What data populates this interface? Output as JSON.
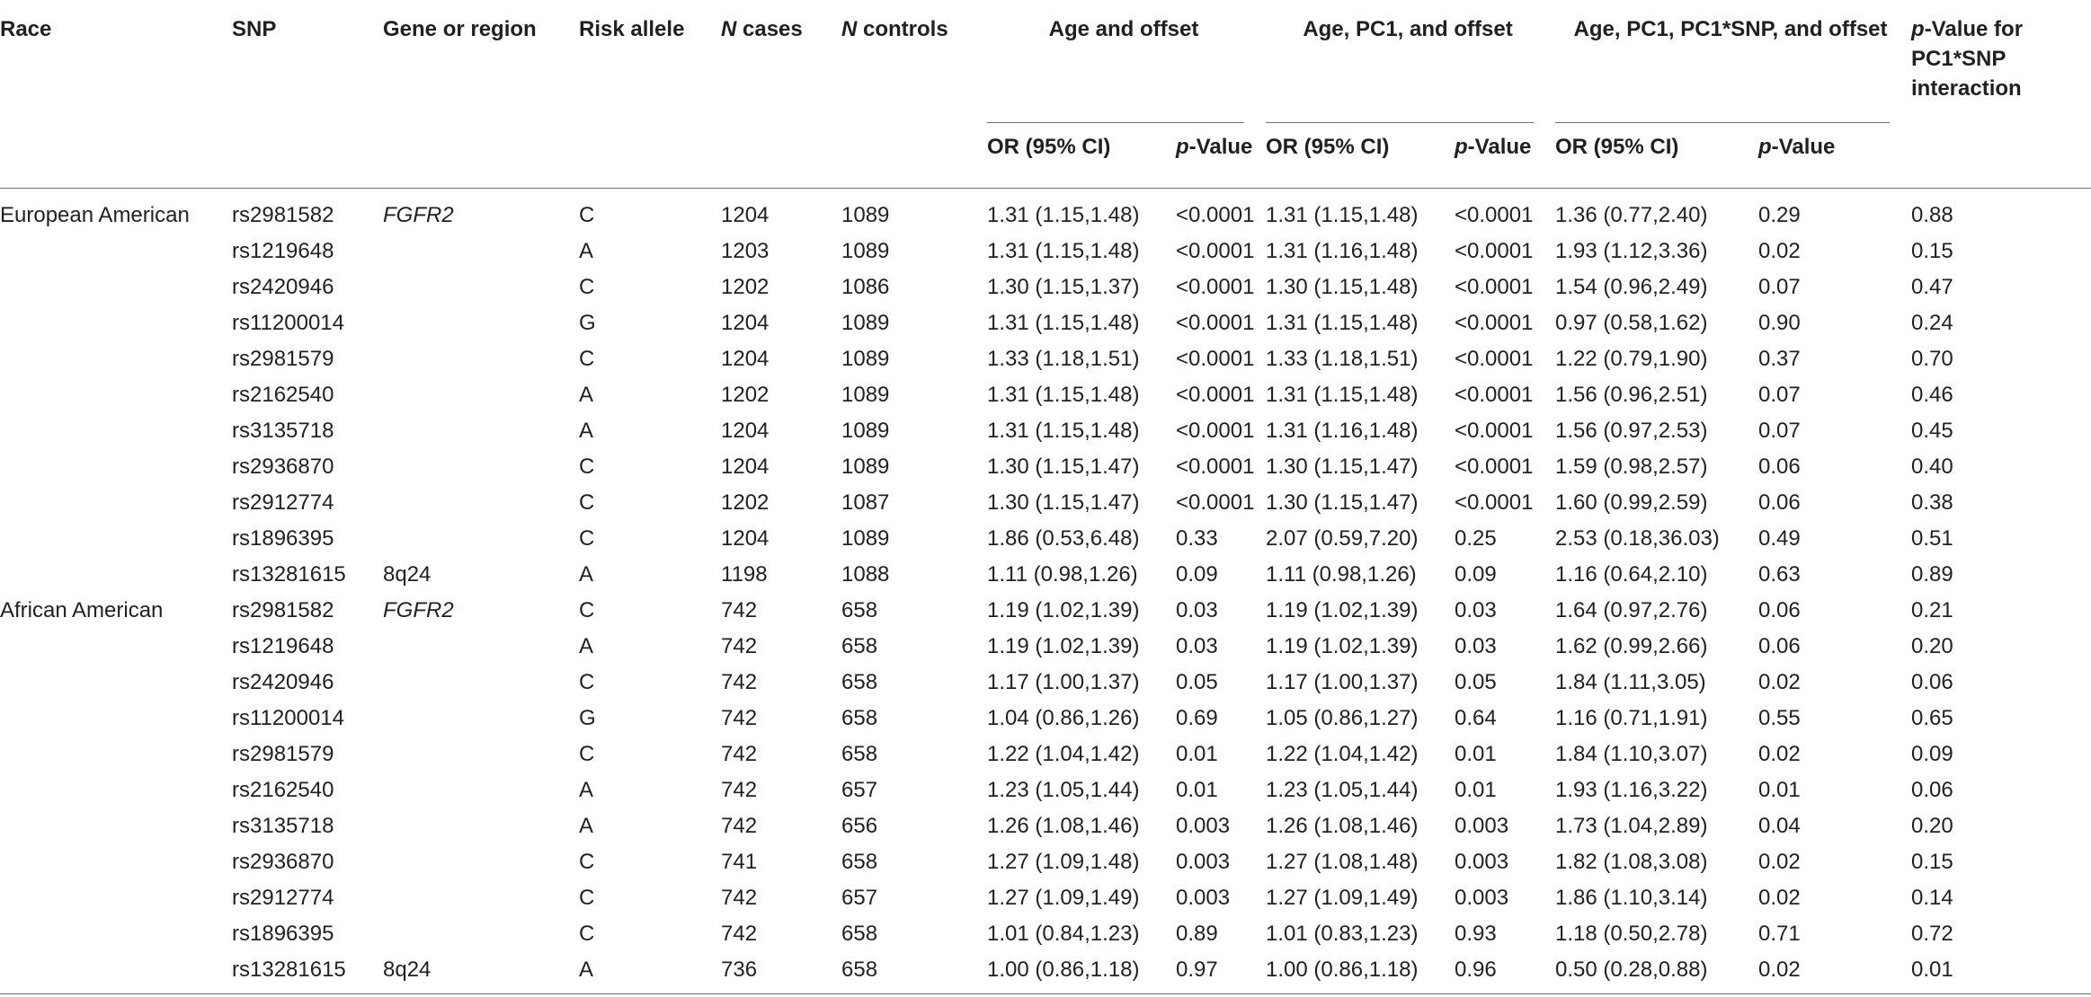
{
  "header": {
    "race": "Race",
    "snp": "SNP",
    "gene": "Gene or region",
    "risk": "Risk allele",
    "ncases_n": "N",
    "ncases_rest": " cases",
    "ncontrols_n": "N",
    "ncontrols_rest": " controls",
    "group1": "Age and offset",
    "group2": "Age, PC1, and offset",
    "group3": "Age, PC1, PC1*SNP, and offset",
    "or": "OR (95% CI)",
    "p_italic": "p",
    "p_rest": "-Value",
    "pint_italic": "p",
    "pint_rest_1": "-Value for",
    "pint_rest_2": "PC1*SNP",
    "pint_rest_3": "interaction"
  },
  "rows": [
    {
      "race": "European American",
      "snp": "rs2981582",
      "gene": "FGFR2",
      "risk": "C",
      "ncases": "1204",
      "ncontrols": "1089",
      "or1": "1.31 (1.15,1.48)",
      "p1": "<0.0001",
      "or2": "1.31 (1.15,1.48)",
      "p2": "<0.0001",
      "or3": "1.36 (0.77,2.40)",
      "p3": "0.29",
      "pint": "0.88"
    },
    {
      "race": "",
      "snp": "rs1219648",
      "gene": "",
      "risk": "A",
      "ncases": "1203",
      "ncontrols": "1089",
      "or1": "1.31 (1.15,1.48)",
      "p1": "<0.0001",
      "or2": "1.31 (1.16,1.48)",
      "p2": "<0.0001",
      "or3": "1.93 (1.12,3.36)",
      "p3": "0.02",
      "pint": "0.15"
    },
    {
      "race": "",
      "snp": "rs2420946",
      "gene": "",
      "risk": "C",
      "ncases": "1202",
      "ncontrols": "1086",
      "or1": "1.30 (1.15,1.37)",
      "p1": "<0.0001",
      "or2": "1.30 (1.15,1.48)",
      "p2": "<0.0001",
      "or3": "1.54 (0.96,2.49)",
      "p3": "0.07",
      "pint": "0.47"
    },
    {
      "race": "",
      "snp": "rs11200014",
      "gene": "",
      "risk": "G",
      "ncases": "1204",
      "ncontrols": "1089",
      "or1": "1.31 (1.15,1.48)",
      "p1": "<0.0001",
      "or2": "1.31 (1.15,1.48)",
      "p2": "<0.0001",
      "or3": "0.97 (0.58,1.62)",
      "p3": "0.90",
      "pint": "0.24"
    },
    {
      "race": "",
      "snp": "rs2981579",
      "gene": "",
      "risk": "C",
      "ncases": "1204",
      "ncontrols": "1089",
      "or1": "1.33 (1.18,1.51)",
      "p1": "<0.0001",
      "or2": "1.33 (1.18,1.51)",
      "p2": "<0.0001",
      "or3": "1.22 (0.79,1.90)",
      "p3": "0.37",
      "pint": "0.70"
    },
    {
      "race": "",
      "snp": "rs2162540",
      "gene": "",
      "risk": "A",
      "ncases": "1202",
      "ncontrols": "1089",
      "or1": "1.31 (1.15,1.48)",
      "p1": "<0.0001",
      "or2": "1.31 (1.15,1.48)",
      "p2": "<0.0001",
      "or3": "1.56 (0.96,2.51)",
      "p3": "0.07",
      "pint": "0.46"
    },
    {
      "race": "",
      "snp": "rs3135718",
      "gene": "",
      "risk": "A",
      "ncases": "1204",
      "ncontrols": "1089",
      "or1": "1.31 (1.15,1.48)",
      "p1": "<0.0001",
      "or2": "1.31 (1.16,1.48)",
      "p2": "<0.0001",
      "or3": "1.56 (0.97,2.53)",
      "p3": "0.07",
      "pint": "0.45"
    },
    {
      "race": "",
      "snp": "rs2936870",
      "gene": "",
      "risk": "C",
      "ncases": "1204",
      "ncontrols": "1089",
      "or1": "1.30 (1.15,1.47)",
      "p1": "<0.0001",
      "or2": "1.30 (1.15,1.47)",
      "p2": "<0.0001",
      "or3": "1.59 (0.98,2.57)",
      "p3": "0.06",
      "pint": "0.40"
    },
    {
      "race": "",
      "snp": "rs2912774",
      "gene": "",
      "risk": "C",
      "ncases": "1202",
      "ncontrols": "1087",
      "or1": "1.30 (1.15,1.47)",
      "p1": "<0.0001",
      "or2": "1.30 (1.15,1.47)",
      "p2": "<0.0001",
      "or3": "1.60 (0.99,2.59)",
      "p3": "0.06",
      "pint": "0.38"
    },
    {
      "race": "",
      "snp": "rs1896395",
      "gene": "",
      "risk": "C",
      "ncases": "1204",
      "ncontrols": "1089",
      "or1": "1.86 (0.53,6.48)",
      "p1": "0.33",
      "or2": "2.07 (0.59,7.20)",
      "p2": "0.25",
      "or3": "2.53 (0.18,36.03)",
      "p3": "0.49",
      "pint": "0.51"
    },
    {
      "race": "",
      "snp": "rs13281615",
      "gene": "8q24",
      "risk": "A",
      "ncases": "1198",
      "ncontrols": "1088",
      "or1": "1.11 (0.98,1.26)",
      "p1": "0.09",
      "or2": "1.11 (0.98,1.26)",
      "p2": "0.09",
      "or3": "1.16 (0.64,2.10)",
      "p3": "0.63",
      "pint": "0.89"
    },
    {
      "race": "African American",
      "snp": "rs2981582",
      "gene": "FGFR2",
      "risk": "C",
      "ncases": "742",
      "ncontrols": "658",
      "or1": "1.19 (1.02,1.39)",
      "p1": "0.03",
      "or2": "1.19 (1.02,1.39)",
      "p2": "0.03",
      "or3": "1.64 (0.97,2.76)",
      "p3": "0.06",
      "pint": "0.21"
    },
    {
      "race": "",
      "snp": "rs1219648",
      "gene": "",
      "risk": "A",
      "ncases": "742",
      "ncontrols": "658",
      "or1": "1.19 (1.02,1.39)",
      "p1": "0.03",
      "or2": "1.19 (1.02,1.39)",
      "p2": "0.03",
      "or3": "1.62 (0.99,2.66)",
      "p3": "0.06",
      "pint": "0.20"
    },
    {
      "race": "",
      "snp": "rs2420946",
      "gene": "",
      "risk": "C",
      "ncases": "742",
      "ncontrols": "658",
      "or1": "1.17 (1.00,1.37)",
      "p1": "0.05",
      "or2": "1.17 (1.00,1.37)",
      "p2": "0.05",
      "or3": "1.84 (1.11,3.05)",
      "p3": "0.02",
      "pint": "0.06"
    },
    {
      "race": "",
      "snp": "rs11200014",
      "gene": "",
      "risk": "G",
      "ncases": "742",
      "ncontrols": "658",
      "or1": "1.04 (0.86,1.26)",
      "p1": "0.69",
      "or2": "1.05 (0.86,1.27)",
      "p2": "0.64",
      "or3": "1.16 (0.71,1.91)",
      "p3": "0.55",
      "pint": "0.65"
    },
    {
      "race": "",
      "snp": "rs2981579",
      "gene": "",
      "risk": "C",
      "ncases": "742",
      "ncontrols": "658",
      "or1": "1.22 (1.04,1.42)",
      "p1": "0.01",
      "or2": "1.22 (1.04,1.42)",
      "p2": "0.01",
      "or3": "1.84 (1.10,3.07)",
      "p3": "0.02",
      "pint": "0.09"
    },
    {
      "race": "",
      "snp": "rs2162540",
      "gene": "",
      "risk": "A",
      "ncases": "742",
      "ncontrols": "657",
      "or1": "1.23 (1.05,1.44)",
      "p1": "0.01",
      "or2": "1.23 (1.05,1.44)",
      "p2": "0.01",
      "or3": "1.93 (1.16,3.22)",
      "p3": "0.01",
      "pint": "0.06"
    },
    {
      "race": "",
      "snp": "rs3135718",
      "gene": "",
      "risk": "A",
      "ncases": "742",
      "ncontrols": "656",
      "or1": "1.26 (1.08,1.46)",
      "p1": "0.003",
      "or2": "1.26 (1.08,1.46)",
      "p2": "0.003",
      "or3": "1.73 (1.04,2.89)",
      "p3": "0.04",
      "pint": "0.20"
    },
    {
      "race": "",
      "snp": "rs2936870",
      "gene": "",
      "risk": "C",
      "ncases": "741",
      "ncontrols": "658",
      "or1": "1.27 (1.09,1.48)",
      "p1": "0.003",
      "or2": "1.27 (1.08,1.48)",
      "p2": "0.003",
      "or3": "1.82 (1.08,3.08)",
      "p3": "0.02",
      "pint": "0.15"
    },
    {
      "race": "",
      "snp": "rs2912774",
      "gene": "",
      "risk": "C",
      "ncases": "742",
      "ncontrols": "657",
      "or1": "1.27 (1.09,1.49)",
      "p1": "0.003",
      "or2": "1.27 (1.09,1.49)",
      "p2": "0.003",
      "or3": "1.86 (1.10,3.14)",
      "p3": "0.02",
      "pint": "0.14"
    },
    {
      "race": "",
      "snp": "rs1896395",
      "gene": "",
      "risk": "C",
      "ncases": "742",
      "ncontrols": "658",
      "or1": "1.01 (0.84,1.23)",
      "p1": "0.89",
      "or2": "1.01 (0.83,1.23)",
      "p2": "0.93",
      "or3": "1.18 (0.50,2.78)",
      "p3": "0.71",
      "pint": "0.72"
    },
    {
      "race": "",
      "snp": "rs13281615",
      "gene": "8q24",
      "risk": "A",
      "ncases": "736",
      "ncontrols": "658",
      "or1": "1.00 (0.86,1.18)",
      "p1": "0.97",
      "or2": "1.00 (0.86,1.18)",
      "p2": "0.96",
      "or3": "0.50 (0.28,0.88)",
      "p3": "0.02",
      "pint": "0.01"
    }
  ]
}
